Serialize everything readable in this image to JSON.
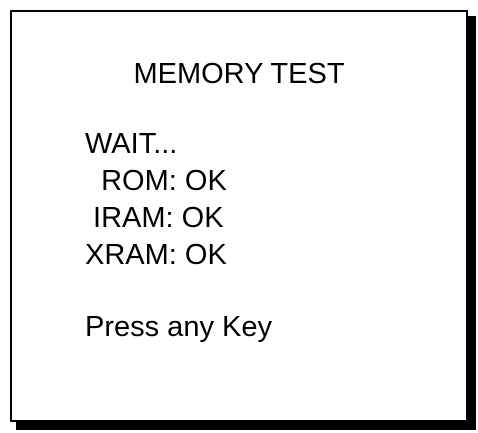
{
  "screen": {
    "title": "MEMORY TEST",
    "status_line": "WAIT...",
    "results": [
      "  ROM: OK",
      " IRAM: OK",
      "XRAM: OK"
    ],
    "prompt": "Press any Key"
  },
  "colors": {
    "background": "#ffffff",
    "text": "#000000",
    "border": "#000000",
    "shadow": "#000000"
  }
}
